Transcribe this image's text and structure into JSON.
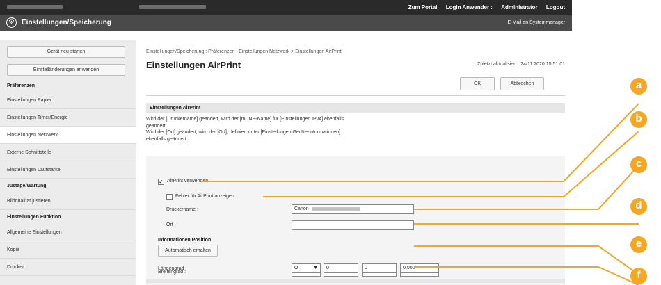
{
  "header": {
    "portal_link": "Zum Portal",
    "login_user": "Login Anwender :",
    "admin": "Administrator",
    "logout": "Logout",
    "title": "Einstellungen/Speicherung",
    "mail_link": "E-Mail an Systemmanager"
  },
  "sidebar": {
    "restart_button": "Gerät neu starten",
    "apply_button": "Einstelländerungen anwenden",
    "sections": [
      {
        "heading": "Präferenzen",
        "items": [
          "Einstellungen Papier",
          "Einstellungen Timer/Energie",
          "Einstellungen Netzwerk",
          "Externe Schnittstelle",
          "Einstellungen Lautstärke"
        ]
      },
      {
        "heading": "Justage/Wartung",
        "items": [
          "Bildqualität justieren"
        ]
      },
      {
        "heading": "Einstellungen Funktion",
        "items": [
          "Allgemeine Einstellungen",
          "Kopie",
          "Drucker"
        ]
      }
    ],
    "active_item": "Einstellungen Netzwerk"
  },
  "main": {
    "breadcrumb": "Einstellungen/Speicherung : Präferenzen : Einstellungen Netzwerk > Einstellungen AirPrint",
    "title": "Einstellungen AirPrint",
    "last_updated": "Zuletzt aktualisiert : 24/11 2020 15:51:01",
    "ok_button": "OK",
    "cancel_button": "Abbrechen",
    "section_title": "Einstellungen AirPrint",
    "description": [
      "Wird der [Druckername] geändert, wird der [mDNS-Name] für [Einstellungen IPv4] ebenfalls",
      "geändert.",
      "Wird der [Ort] geändert, wird der [Ort], definiert unter [Einstellungen Geräte-Informationen]",
      "ebenfalls geändert."
    ],
    "use_airprint": {
      "label": "AirPrint verwenden",
      "checked": true
    },
    "show_errors": {
      "label": "Fehler für AirPrint anzeigen",
      "checked": false
    },
    "printer_name": {
      "label": "Druckername :",
      "value": "Canon"
    },
    "location": {
      "label": "Ort :",
      "value": ""
    },
    "position": {
      "heading": "Informationen Position",
      "auto_button": "Automatisch erhalten",
      "latitude": {
        "label": "Breitengrad :",
        "direction": "N",
        "deg": "0",
        "min": "0",
        "sec": "0.000"
      },
      "longitude": {
        "label": "Längengrad :",
        "direction": "O",
        "deg": "0",
        "min": "0",
        "sec": "0.000"
      }
    }
  },
  "callouts": [
    "a",
    "b",
    "c",
    "d",
    "e",
    "f"
  ],
  "colors": {
    "callout": "#f5a623",
    "topbar": "#2a2a2a",
    "titlebar": "#4a4a4a"
  }
}
